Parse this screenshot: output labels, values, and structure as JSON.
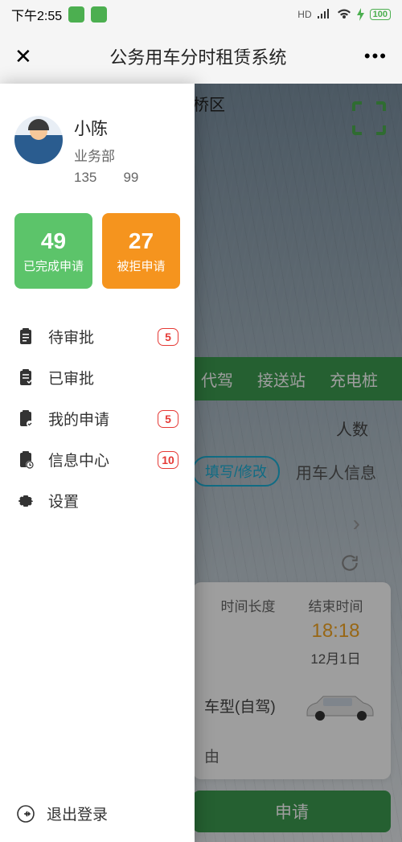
{
  "status": {
    "time": "下午2:55",
    "hd": "HD",
    "battery": "100"
  },
  "nav": {
    "title": "公务用车分时租赁系统"
  },
  "bg": {
    "location_suffix": "桥区",
    "tabs": {
      "t2": "代驾",
      "t3": "接送站",
      "t4": "充电桩"
    },
    "form": {
      "people_label": "人数",
      "fill_btn": "填写/修改",
      "user_info": "用车人信息"
    },
    "card": {
      "dur_label": "时间长度",
      "end_label": "结束时间",
      "end_time": "18:18",
      "end_date": "12月1日",
      "car_type": "车型(自驾)",
      "reason": "由"
    },
    "submit": "申请"
  },
  "drawer": {
    "profile": {
      "name": "小陈",
      "dept": "业务部",
      "phone_a": "135",
      "phone_b": "99"
    },
    "stats": {
      "done": {
        "num": "49",
        "label": "已完成申请"
      },
      "rejected": {
        "num": "27",
        "label": "被拒申请"
      }
    },
    "menu": {
      "m1": {
        "label": "待审批",
        "badge": "5"
      },
      "m2": {
        "label": "已审批"
      },
      "m3": {
        "label": "我的申请",
        "badge": "5"
      },
      "m4": {
        "label": "信息中心",
        "badge": "10"
      },
      "m5": {
        "label": "设置"
      }
    },
    "logout": "退出登录"
  }
}
